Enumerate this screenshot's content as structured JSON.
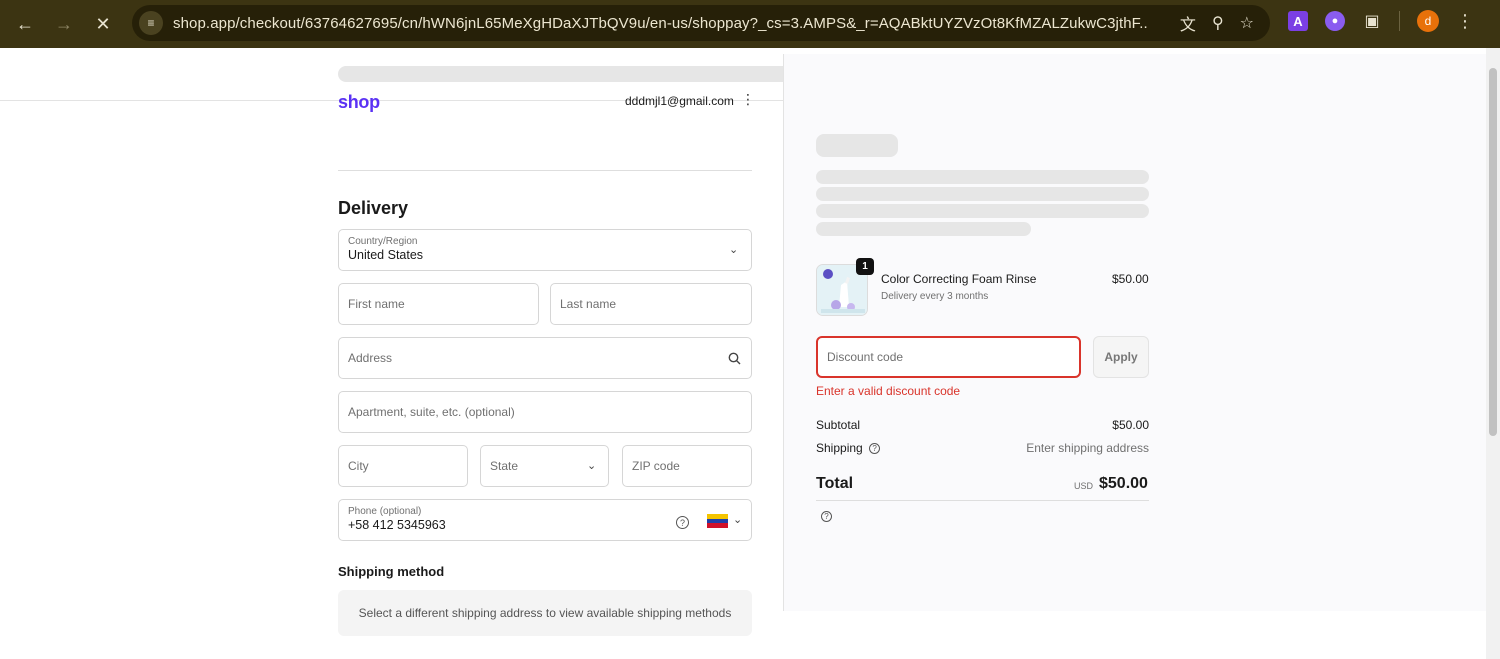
{
  "browser": {
    "url": "shop.app/checkout/63764627695/cn/hWN6jnL65MeXgHDaXJTbQV9u/en-us/shoppay?_cs=3.AMPS&_r=AQABktUYZVzOt8KfMZALZukwC3jthF...",
    "avatar_letter": "d",
    "ext_a_letter": "A"
  },
  "header": {
    "logo": "shop",
    "account_email": "dddmjl1@gmail.com"
  },
  "delivery": {
    "title": "Delivery",
    "country_label": "Country/Region",
    "country_value": "United States",
    "first_name_placeholder": "First name",
    "last_name_placeholder": "Last name",
    "address_placeholder": "Address",
    "apartment_placeholder": "Apartment, suite, etc. (optional)",
    "city_placeholder": "City",
    "state_placeholder": "State",
    "zip_placeholder": "ZIP code",
    "phone_label": "Phone (optional)",
    "phone_value": "+58 412 5345963"
  },
  "shipping_method": {
    "title": "Shipping method",
    "message": "Select a different shipping address to view available shipping methods"
  },
  "summary": {
    "item": {
      "quantity": "1",
      "name": "Color Correcting Foam Rinse",
      "subtitle": "Delivery every 3 months",
      "price": "$50.00"
    },
    "discount_placeholder": "Discount code",
    "apply_label": "Apply",
    "discount_error": "Enter a valid discount code",
    "subtotal_label": "Subtotal",
    "subtotal_value": "$50.00",
    "shipping_label": "Shipping",
    "shipping_value": "Enter shipping address",
    "total_label": "Total",
    "total_currency": "USD",
    "total_value": "$50.00"
  },
  "colors": {
    "brand": "#5a31f4",
    "error": "#d9342b",
    "chrome": "#3c3412"
  }
}
